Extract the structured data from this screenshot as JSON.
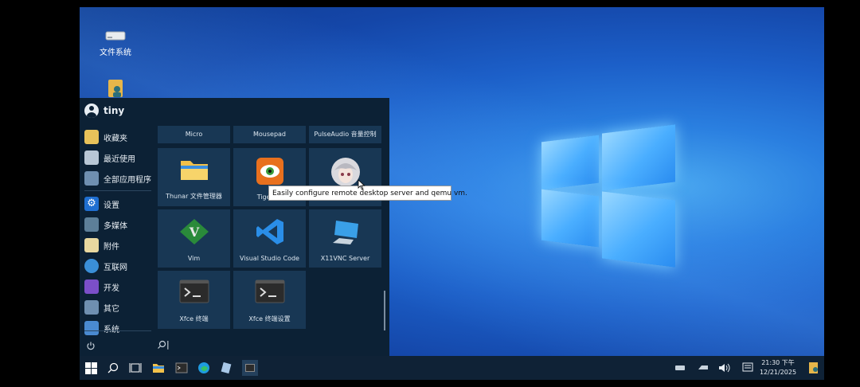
{
  "desktop": {
    "icons": [
      {
        "label": "文件系统",
        "icon": "drive-icon"
      },
      {
        "label": "",
        "icon": "home-folder-icon"
      }
    ]
  },
  "start_menu": {
    "user": "tiny",
    "nav_items": [
      {
        "label": "收藏夹",
        "icon": "favorites-icon"
      },
      {
        "label": "最近使用",
        "icon": "recent-icon"
      },
      {
        "label": "全部应用程序",
        "icon": "all-apps-icon"
      },
      {
        "label": "设置",
        "icon": "settings-icon"
      },
      {
        "label": "多媒体",
        "icon": "multimedia-icon"
      },
      {
        "label": "附件",
        "icon": "accessories-icon"
      },
      {
        "label": "互联网",
        "icon": "internet-icon"
      },
      {
        "label": "开发",
        "icon": "development-icon"
      },
      {
        "label": "其它",
        "icon": "other-icon"
      },
      {
        "label": "系统",
        "icon": "system-icon"
      }
    ],
    "top_tiles": [
      "Micro",
      "Mousepad",
      "PulseAudio 音量控制"
    ],
    "tiles": [
      {
        "label": "Thunar 文件管理器",
        "icon": "folder-icon"
      },
      {
        "label": "TigerVN",
        "icon": "tigervnc-icon"
      },
      {
        "label": "",
        "icon": "anime-avatar-icon"
      },
      {
        "label": "Vim",
        "icon": "vim-icon"
      },
      {
        "label": "Visual Studio Code",
        "icon": "vscode-icon"
      },
      {
        "label": "X11VNC Server",
        "icon": "monitor-icon"
      },
      {
        "label": "Xfce 终端",
        "icon": "terminal-icon"
      },
      {
        "label": "Xfce 终端设置",
        "icon": "terminal-settings-icon"
      }
    ],
    "tooltip": "Easily configure remote desktop server and qemu vm.",
    "search_placeholder": "|"
  },
  "taskbar": {
    "time": "21:30 下午",
    "date": "12/21/2025"
  },
  "colors": {
    "menu_bg": "#0c2135",
    "tile_bg": "#183754",
    "taskbar_bg": "#0f2236"
  }
}
